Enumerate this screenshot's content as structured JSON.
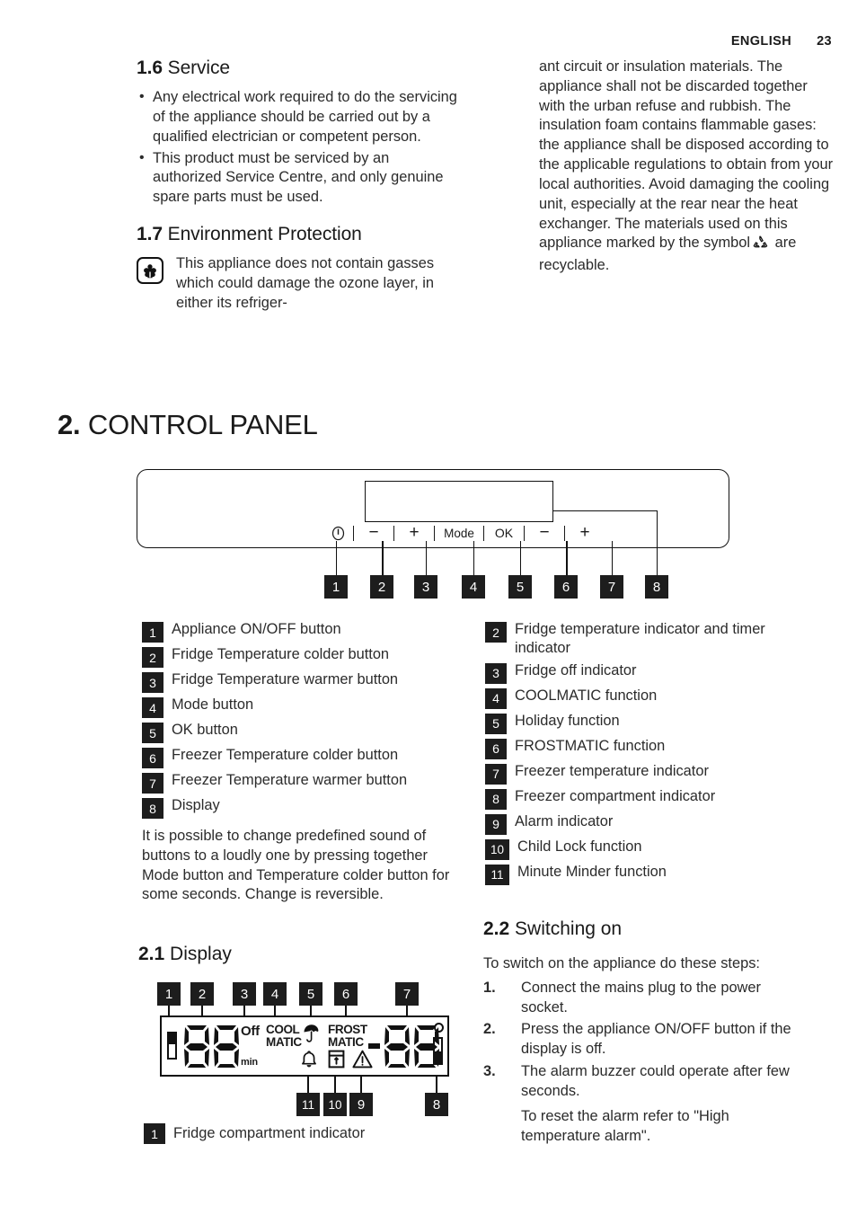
{
  "header": {
    "language": "ENGLISH",
    "page_number": "23"
  },
  "section_1_6": {
    "number": "1.6",
    "title": "Service",
    "bullets": [
      "Any electrical work required to do the servicing of the appliance should be carried out by a qualified electrician or competent person.",
      "This product must be serviced by an authorized Service Centre, and only genuine spare parts must be used."
    ]
  },
  "section_1_7": {
    "number": "1.7",
    "title": "Environment Protection",
    "icon": "flower-icon",
    "text_left": "This appliance does not contain gasses which could damage the ozone layer, in either its refriger-",
    "text_right_part1": "ant circuit or insulation materials. The appliance shall not be discarded together with the urban refuse and rubbish. The insulation foam contains flammable gases: the appliance shall be disposed according to the applicable regulations to obtain from your local authorities. Avoid damaging the cooling unit, especially at the rear near the heat exchanger. The materials used on this appliance marked by the symbol",
    "text_right_part2": "are recyclable.",
    "recycle_icon": "recycle-icon"
  },
  "chapter_2": {
    "number": "2.",
    "title": "CONTROL PANEL"
  },
  "control_panel": {
    "buttons": [
      {
        "id": "1",
        "icon": "power-icon",
        "label": ""
      },
      {
        "id": "2",
        "icon": "minus-icon",
        "label": "−"
      },
      {
        "id": "3",
        "icon": "plus-icon",
        "label": "+"
      },
      {
        "id": "4",
        "icon": "mode-button",
        "label": "Mode"
      },
      {
        "id": "5",
        "icon": "ok-button",
        "label": "OK"
      },
      {
        "id": "6",
        "icon": "minus-icon",
        "label": "−"
      },
      {
        "id": "7",
        "icon": "plus-icon",
        "label": "+"
      }
    ],
    "callouts": [
      "1",
      "2",
      "3",
      "4",
      "5",
      "6",
      "7",
      "8"
    ]
  },
  "legend_left": [
    {
      "num": "1",
      "label": "Appliance ON/OFF button"
    },
    {
      "num": "2",
      "label": "Fridge Temperature colder button"
    },
    {
      "num": "3",
      "label": "Fridge Temperature warmer button"
    },
    {
      "num": "4",
      "label": "Mode button"
    },
    {
      "num": "5",
      "label": "OK button"
    },
    {
      "num": "6",
      "label": "Freezer Temperature colder button"
    },
    {
      "num": "7",
      "label": "Freezer Temperature warmer button"
    },
    {
      "num": "8",
      "label": "Display"
    }
  ],
  "legend_note": "It is possible to change predefined sound of buttons to a loudly one by pressing together Mode button and Temperature colder button for some seconds. Change is reversible.",
  "legend_right": [
    {
      "num": "2",
      "label": "Fridge temperature indicator and timer indicator"
    },
    {
      "num": "3",
      "label": "Fridge off indicator"
    },
    {
      "num": "4",
      "label": "COOLMATIC function"
    },
    {
      "num": "5",
      "label": "Holiday function"
    },
    {
      "num": "6",
      "label": "FROSTMATIC function"
    },
    {
      "num": "7",
      "label": "Freezer temperature indicator"
    },
    {
      "num": "8",
      "label": "Freezer compartment indicator"
    },
    {
      "num": "9",
      "label": "Alarm indicator"
    },
    {
      "num": "10",
      "label": "Child Lock function"
    },
    {
      "num": "11",
      "label": "Minute Minder function"
    }
  ],
  "section_2_1": {
    "number": "2.1",
    "title": "Display",
    "lcd": {
      "fridge_bar": "fridge-compartment-bar",
      "fridge_digits": "88",
      "off_label": "Off",
      "min_label": "min",
      "coolmatic_line1": "COOL",
      "coolmatic_line2": "MATIC",
      "holiday_icon": "umbrella-icon",
      "frostmatic_line1": "FROST",
      "frostmatic_line2": "MATIC",
      "minus_sign": "−",
      "freezer_digits": "88",
      "degree_symbol": "degree-circle-icon",
      "freezer_bar": "freezer-compartment-bar",
      "alarm_icon": "bell-icon",
      "child_lock_icon": "child-lock-icon",
      "warning_icon": "warning-triangle-icon"
    },
    "callouts_top": [
      "1",
      "2",
      "3",
      "4",
      "5",
      "6",
      "7"
    ],
    "callouts_bottom": [
      "11",
      "10",
      "9",
      "8"
    ],
    "caption_num": "1",
    "caption_label": "Fridge compartment indicator"
  },
  "section_2_2": {
    "number": "2.2",
    "title": "Switching on",
    "intro": "To switch on the appliance do these steps:",
    "steps": [
      {
        "num": "1.",
        "text": "Connect the mains plug to the power socket."
      },
      {
        "num": "2.",
        "text": "Press the appliance ON/OFF button if the display is off."
      },
      {
        "num": "3.",
        "text": "The alarm buzzer could operate after few seconds."
      }
    ],
    "closing": "To reset the alarm refer to \"High temperature alarm\"."
  },
  "colors": {
    "ink": "#1a1a1a",
    "badge_bg": "#1d1d1d",
    "badge_text": "#ffffff",
    "body": "#2b2b2b"
  }
}
